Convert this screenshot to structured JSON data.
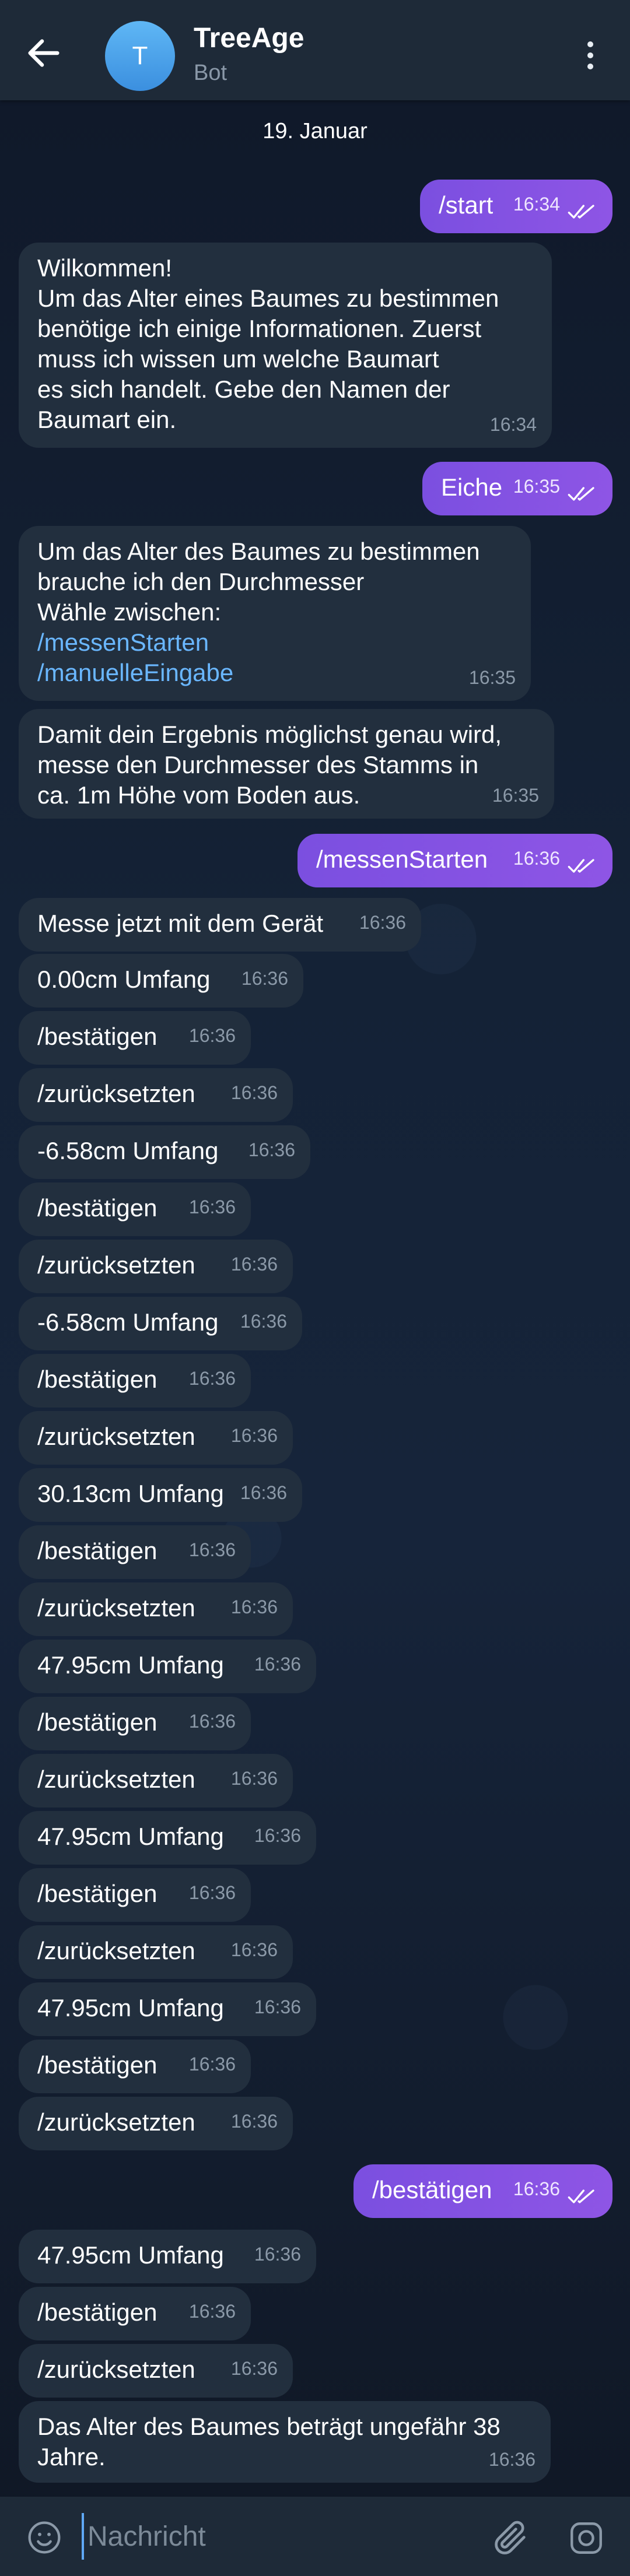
{
  "header": {
    "title": "TreeAge",
    "subtitle": "Bot",
    "avatar_letter": "T"
  },
  "date_label": "19. Januar",
  "messages": [
    {
      "dir": "out",
      "text": "/start",
      "time": "16:34"
    },
    {
      "dir": "in",
      "lines": [
        "Wilkommen!",
        "Um das Alter eines Baumes zu bestimmen",
        "benötige ich einige Informationen. Zuerst",
        "muss ich wissen um welche Baumart",
        "es sich handelt. Gebe den Namen der",
        "Baumart ein."
      ],
      "time": "16:34"
    },
    {
      "dir": "out",
      "text": "Eiche",
      "time": "16:35"
    },
    {
      "dir": "in",
      "lines": [
        "Um das Alter des Baumes zu bestimmen",
        "brauche ich den Durchmesser",
        "Wähle zwischen:"
      ],
      "links": [
        "/messenStarten",
        "/manuelleEingabe"
      ],
      "time": "16:35"
    },
    {
      "dir": "in",
      "lines": [
        "Damit dein Ergebnis möglichst genau wird,",
        "messe den Durchmesser des Stamms in",
        "ca. 1m Höhe vom Boden aus."
      ],
      "time": "16:35"
    },
    {
      "dir": "out",
      "text": "/messenStarten",
      "time": "16:36"
    },
    {
      "dir": "in",
      "text": "Messe jetzt mit dem Gerät",
      "time": "16:36"
    },
    {
      "dir": "in",
      "text": "0.00cm Umfang",
      "time": "16:36"
    },
    {
      "dir": "in",
      "text": "/bestätigen",
      "time": "16:36"
    },
    {
      "dir": "in",
      "text": "/zurücksetzten",
      "time": "16:36"
    },
    {
      "dir": "in",
      "text": "-6.58cm Umfang",
      "time": "16:36"
    },
    {
      "dir": "in",
      "text": "/bestätigen",
      "time": "16:36"
    },
    {
      "dir": "in",
      "text": "/zurücksetzten",
      "time": "16:36"
    },
    {
      "dir": "in",
      "text": "-6.58cm Umfang",
      "time": "16:36"
    },
    {
      "dir": "in",
      "text": "/bestätigen",
      "time": "16:36"
    },
    {
      "dir": "in",
      "text": "/zurücksetzten",
      "time": "16:36"
    },
    {
      "dir": "in",
      "text": "30.13cm Umfang",
      "time": "16:36"
    },
    {
      "dir": "in",
      "text": "/bestätigen",
      "time": "16:36"
    },
    {
      "dir": "in",
      "text": "/zurücksetzten",
      "time": "16:36"
    },
    {
      "dir": "in",
      "text": "47.95cm Umfang",
      "time": "16:36"
    },
    {
      "dir": "in",
      "text": "/bestätigen",
      "time": "16:36"
    },
    {
      "dir": "in",
      "text": "/zurücksetzten",
      "time": "16:36"
    },
    {
      "dir": "in",
      "text": "47.95cm Umfang",
      "time": "16:36"
    },
    {
      "dir": "in",
      "text": "/bestätigen",
      "time": "16:36"
    },
    {
      "dir": "in",
      "text": "/zurücksetzten",
      "time": "16:36"
    },
    {
      "dir": "in",
      "text": "47.95cm Umfang",
      "time": "16:36"
    },
    {
      "dir": "in",
      "text": "/bestätigen",
      "time": "16:36"
    },
    {
      "dir": "in",
      "text": "/zurücksetzten",
      "time": "16:36"
    },
    {
      "dir": "out",
      "text": "/bestätigen",
      "time": "16:36"
    },
    {
      "dir": "in",
      "text": "47.95cm Umfang",
      "time": "16:36"
    },
    {
      "dir": "in",
      "text": "/bestätigen",
      "time": "16:36"
    },
    {
      "dir": "in",
      "text": "/zurücksetzten",
      "time": "16:36"
    },
    {
      "dir": "in",
      "lines": [
        "Das Alter des Baumes beträgt ungefähr 38",
        "Jahre."
      ],
      "time": "16:36"
    }
  ],
  "input": {
    "placeholder": "Nachricht"
  },
  "icons": {
    "back": "arrow-left-icon",
    "menu": "more-vertical-icon",
    "emoji": "emoji-icon",
    "attach": "paperclip-icon",
    "camera": "camera-icon",
    "read": "double-check-icon"
  },
  "colors": {
    "header_bg": "#1e2a38",
    "incoming_bubble": "#222f3e",
    "outgoing_bubble": "#8052e2",
    "link": "#6ab7ff",
    "accent": "#5fa8f5"
  }
}
